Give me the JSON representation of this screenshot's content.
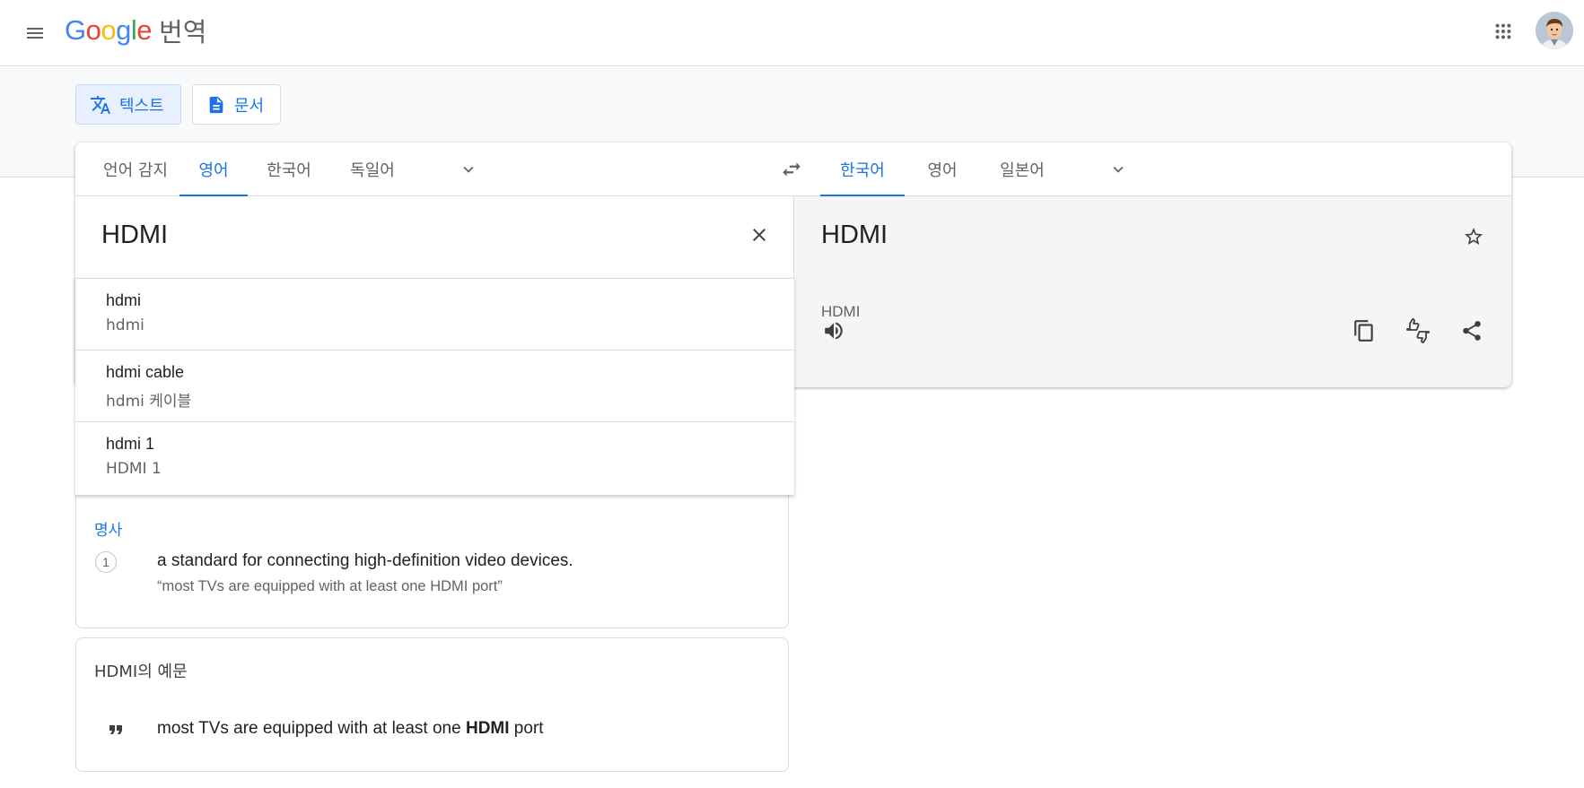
{
  "app": {
    "logo_text": "Google",
    "product_name": "번역"
  },
  "modes": [
    {
      "label": "텍스트",
      "icon": "translate-icon",
      "active": true
    },
    {
      "label": "문서",
      "icon": "document-icon",
      "active": false
    }
  ],
  "source_langs": [
    "언어 감지",
    "영어",
    "한국어",
    "독일어"
  ],
  "source_selected": "영어",
  "target_langs": [
    "한국어",
    "영어",
    "일본어"
  ],
  "target_selected": "한국어",
  "source_text": "HDMI",
  "target_text": "HDMI",
  "target_romanization": "HDMI",
  "suggestions": [
    {
      "main": "hdmi",
      "sub": "hdmi"
    },
    {
      "main": "hdmi cable",
      "sub": "hdmi 케이블"
    },
    {
      "main": "hdmi 1",
      "sub": "HDMI 1"
    }
  ],
  "dictionary": {
    "part_of_speech": "명사",
    "number": "1",
    "definition": "a standard for connecting high-definition video devices.",
    "example": "“most TVs are equipped with at least one HDMI port”"
  },
  "examples": {
    "title": "HDMI의 예문",
    "sentence_before": "most TVs are equipped with at least one ",
    "sentence_bold": "HDMI",
    "sentence_after": " port"
  },
  "colors": {
    "accent": "#1a73e8",
    "google_blue": "#4285f4",
    "google_red": "#ea4335",
    "google_yellow": "#fbbc05",
    "google_green": "#34a853"
  }
}
